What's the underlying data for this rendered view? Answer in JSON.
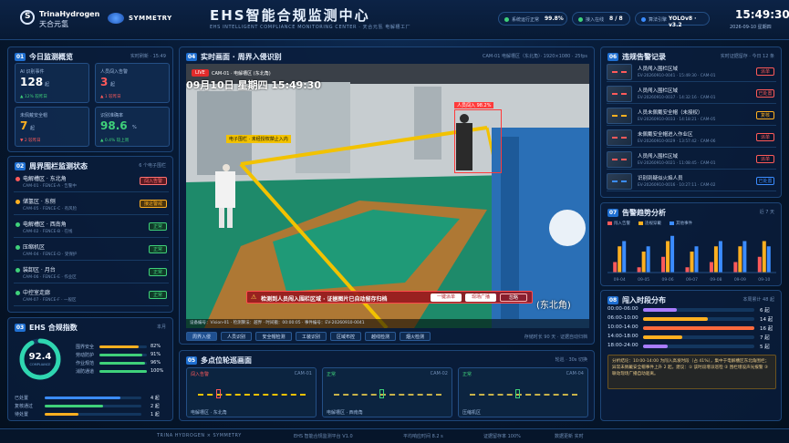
{
  "header": {
    "brand_en": "TrinaHydrogen",
    "brand_cn": "天合元氢",
    "partner": "SYMMETRY",
    "title": "EHS智能合规监测中心",
    "subtitle": "EHS INTELLIGENT COMPLIANCE MONITORING CENTER · 天合元氢 电解槽工厂",
    "stats": [
      {
        "label": "系统运行正常",
        "value": "99.8%"
      },
      {
        "label": "接入在线",
        "value": "8 / 8"
      },
      {
        "label": "算法引擎",
        "value": "YOLOv8 · v3.2"
      }
    ],
    "time": "15:49:30",
    "date": "2026-09-10 星期四"
  },
  "today": {
    "title": "今日监测概览",
    "num": "01",
    "meta": "实时刷新 · 15:49",
    "cards": [
      {
        "label": "AI 识别事件",
        "value": "128",
        "unit": "起",
        "trend": "▲ 12% 较昨日",
        "color": "#ffffff",
        "trend_color": "#3fd17a"
      },
      {
        "label": "人员闯入告警",
        "value": "3",
        "unit": "起",
        "trend": "▲ 1 较昨日",
        "color": "#ff5a5a",
        "trend_color": "#ff5a5a"
      },
      {
        "label": "未佩戴安全帽",
        "value": "7",
        "unit": "起",
        "trend": "▼ 2 较昨日",
        "color": "#ffb020",
        "trend_color": "#ff5a5a"
      },
      {
        "label": "识别准确率",
        "value": "98.6",
        "unit": "%",
        "trend": "▲ 0.4% 较上周",
        "color": "#3fd17a",
        "trend_color": "#3fd17a"
      }
    ]
  },
  "fence": {
    "title": "周界围栏监测状态",
    "num": "02",
    "meta": "6 个电子围栏",
    "items": [
      {
        "name": "电解槽区 · 东北角",
        "sub": "CAM-01 · FENCE-A · 告警中",
        "status": "闯入告警",
        "dot": "#ff5a5a",
        "bg": "#5a1a22",
        "fg": "#ff7070"
      },
      {
        "name": "储氢区 · 东侧",
        "sub": "CAM-05 · FENCE-C · 有风险",
        "status": "接近警戒",
        "dot": "#ffb020",
        "bg": "#4a3510",
        "fg": "#ffb020"
      },
      {
        "name": "电解槽区 · 西南角",
        "sub": "CAM-02 · FENCE-B · 在线",
        "status": "正常",
        "dot": "#3fd17a",
        "bg": "#103a28",
        "fg": "#3fd17a"
      },
      {
        "name": "压缩机区",
        "sub": "CAM-04 · FENCE-D · 受保护",
        "status": "正常",
        "dot": "#3fd17a",
        "bg": "#103a28",
        "fg": "#3fd17a"
      },
      {
        "name": "装卸区 · 月台",
        "sub": "CAM-06 · FENCE-E · 作业区",
        "status": "正常",
        "dot": "#3fd17a",
        "bg": "#103a28",
        "fg": "#3fd17a"
      },
      {
        "name": "中控室走廊",
        "sub": "CAM-07 · FENCE-F · 一般区",
        "status": "正常",
        "dot": "#3fd17a",
        "bg": "#103a28",
        "fg": "#3fd17a"
      }
    ]
  },
  "ehs": {
    "title": "EHS 合规指数",
    "num": "03",
    "meta": "本月",
    "score": "92.4",
    "score_label": "COMPLIANCE",
    "score_pct": 92.4,
    "bars": [
      {
        "label": "围界安全",
        "pct": 82,
        "value": "82%",
        "color": "#ffb020"
      },
      {
        "label": "劳动防护",
        "pct": 91,
        "value": "91%",
        "color": "#3fd17a"
      },
      {
        "label": "作业规范",
        "pct": 96,
        "value": "96%",
        "color": "#3fd17a"
      },
      {
        "label": "消防通道",
        "pct": 100,
        "value": "100%",
        "color": "#3fd17a"
      }
    ],
    "rows": [
      {
        "label": "已处置",
        "pct": 78,
        "value": "4 起",
        "color": "#3b8cff"
      },
      {
        "label": "复核通过",
        "pct": 60,
        "value": "2 起",
        "color": "#3fd17a"
      },
      {
        "label": "待处置",
        "pct": 35,
        "value": "1 起",
        "color": "#ffb020"
      }
    ]
  },
  "video": {
    "title": "实时画面 · 周界入侵识别",
    "num": "04",
    "meta": "CAM-01 电解槽区（东北角）· 1920×1080 · 25fps",
    "cam": "CAM-01 · 电解槽区 (东北角)",
    "live": "LIVE",
    "osd": "09月10日  星期四  15:49:30",
    "osd_corner": "(东北角)",
    "intrusion_tag": "人员闯入 98.2%",
    "fence_tag": "电子围栏 · 未经授权禁止入内",
    "alert": "检测到人员闯入围栏区域 · 证据图片已自动留存归档",
    "alert_buttons": [
      "一键派单",
      "现场广播",
      "忽略"
    ],
    "meta_bar": "设备编号：Vision-01 · 检测算法：越界 · 时间戳：00:00:05 · 事件编号：EV-20260910-0041",
    "toolbar": [
      "周界入侵",
      "人员识别",
      "安全帽检测",
      "工装识别",
      "区域布控",
      "越线检测",
      "烟火检测"
    ],
    "toolbar_right": "存储时长 90 天 · 证据自动归档"
  },
  "multi": {
    "title": "多点位轮巡画面",
    "num": "05",
    "meta": "轮巡 · 30s 切换",
    "cams": [
      {
        "tag": "闯入告警",
        "cam": "CAM-01",
        "name": "电解槽区 · 东北角",
        "color": "#ff5a5a"
      },
      {
        "tag": "正常",
        "cam": "CAM-02",
        "name": "电解槽区 · 西南角",
        "color": "#3fd17a"
      },
      {
        "tag": "正常",
        "cam": "CAM-04",
        "name": "压缩机区",
        "color": "#3fd17a"
      }
    ]
  },
  "records": {
    "title": "违规告警记录",
    "num": "06",
    "meta": "实时证据留存 · 今日 12 条",
    "items": [
      {
        "name": "人员闯入围栏区域",
        "sub": "EV-20260910-0041 · 15:49:30 · CAM-01",
        "btn": "派单",
        "color": "#ff5a5a"
      },
      {
        "name": "人员闯入围栏区域",
        "sub": "EV-20260910-0037 · 14:32:16 · CAM-01",
        "btn": "已处置",
        "color": "#ff5a5a"
      },
      {
        "name": "人员未佩戴安全帽（未授权）",
        "sub": "EV-20260910-0033 · 14:18:21 · CAM-05",
        "btn": "复核",
        "color": "#ffb020"
      },
      {
        "name": "未佩戴安全帽进入作业区",
        "sub": "EV-20260910-0029 · 13:57:42 · CAM-06",
        "btn": "派单",
        "color": "#ff5a5a"
      },
      {
        "name": "人员闯入围栏区域",
        "sub": "EV-20260910-0021 · 11:08:45 · CAM-01",
        "btn": "派单",
        "color": "#ff5a5a"
      },
      {
        "name": "识别到疑似火焰人员",
        "sub": "EV-20260910-0016 · 10:27:11 · CAM-02",
        "btn": "已处置",
        "color": "#3b8cff"
      }
    ]
  },
  "trend": {
    "title": "告警趋势分析",
    "num": "07",
    "meta": "近 7 天",
    "legend": [
      {
        "label": "闯入告警",
        "color": "#ff5a5a"
      },
      {
        "label": "违规穿戴",
        "color": "#ffb020"
      },
      {
        "label": "其他事件",
        "color": "#3b8cff"
      }
    ]
  },
  "chart_data": {
    "type": "bar",
    "categories": [
      "09-04",
      "09-05",
      "09-06",
      "09-07",
      "09-08",
      "09-09",
      "09-10"
    ],
    "series": [
      {
        "name": "闯入告警",
        "values": [
          2,
          1,
          3,
          1,
          2,
          2,
          3
        ]
      },
      {
        "name": "违规穿戴",
        "values": [
          5,
          4,
          6,
          4,
          5,
          5,
          6
        ]
      },
      {
        "name": "其他事件",
        "values": [
          6,
          5,
          7,
          5,
          6,
          6,
          5
        ]
      }
    ],
    "ylim": [
      0,
      8
    ],
    "legend": "top-left"
  },
  "period": {
    "title": "闯入时段分布",
    "num": "08",
    "meta": "本周累计 48 起",
    "rows": [
      {
        "label": "00:00-06:00",
        "pct": 30,
        "value": "6 起",
        "color": "#a87cff"
      },
      {
        "label": "06:00-10:00",
        "pct": 58,
        "value": "14 起",
        "color": "#ffb020"
      },
      {
        "label": "10:00-14:00",
        "pct": 100,
        "value": "16 起",
        "color": "#ff6a3d"
      },
      {
        "label": "14:00-18:00",
        "pct": 35,
        "value": "7 起",
        "color": "#ffb020"
      },
      {
        "label": "18:00-24:00",
        "pct": 22,
        "value": "5 起",
        "color": "#a87cff"
      }
    ],
    "note": "分析结论：10:00-14:00 为闯入高发时段（占 41%），集中于电解槽区东北角围栏；异常未佩戴安全帽事件上升 2 起。建议：① 该时段增派巡检 ② 围栏增设声光报警 ③ 联动现场广播自动驱离。"
  },
  "footer": {
    "left": "TRINA HYDROGEN × SYMMETRY",
    "center": "EHS 智能合规监测平台 V1.0",
    "items": [
      "平均响应时间 8.2 s",
      "证据留存率 100%",
      "数据更新 实时"
    ]
  }
}
